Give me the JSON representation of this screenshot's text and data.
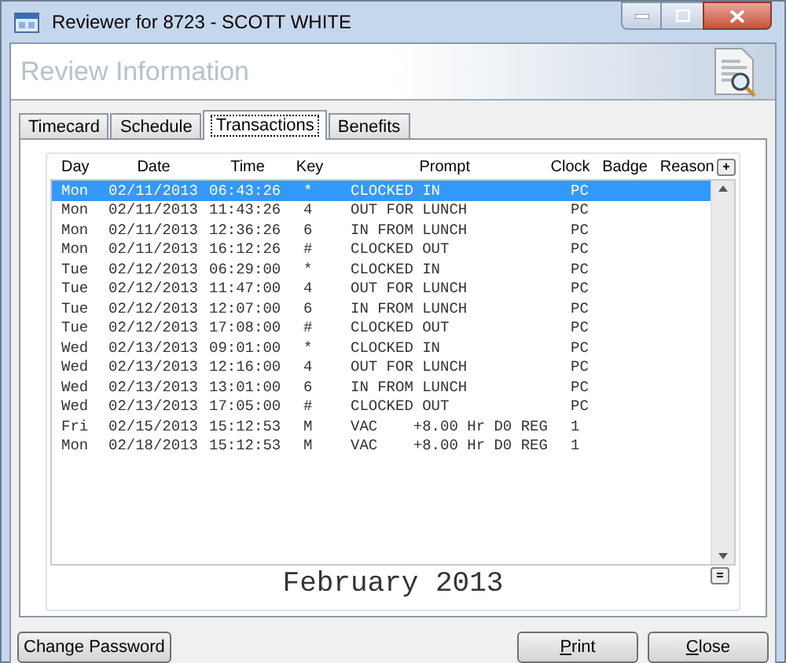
{
  "window": {
    "title": "Reviewer for 8723 - SCOTT WHITE"
  },
  "header": {
    "title": "Review Information"
  },
  "tabs": [
    {
      "label": "Timecard",
      "selected": false
    },
    {
      "label": "Schedule",
      "selected": false
    },
    {
      "label": "Transactions",
      "selected": true
    },
    {
      "label": "Benefits",
      "selected": false
    }
  ],
  "table": {
    "columns": [
      "Day",
      "Date",
      "Time",
      "Key",
      "Prompt",
      "Clock",
      "Badge",
      "Reason"
    ],
    "rows": [
      {
        "day": "Mon",
        "date": "02/11/2013",
        "time": "06:43:26",
        "key": "*",
        "prompt": "CLOCKED IN",
        "clock": "PC",
        "selected": true
      },
      {
        "day": "Mon",
        "date": "02/11/2013",
        "time": "11:43:26",
        "key": "4",
        "prompt": "OUT FOR LUNCH",
        "clock": "PC",
        "selected": false
      },
      {
        "day": "Mon",
        "date": "02/11/2013",
        "time": "12:36:26",
        "key": "6",
        "prompt": "IN FROM LUNCH",
        "clock": "PC",
        "selected": false
      },
      {
        "day": "Mon",
        "date": "02/11/2013",
        "time": "16:12:26",
        "key": "#",
        "prompt": "CLOCKED OUT",
        "clock": "PC",
        "selected": false
      },
      {
        "day": "Tue",
        "date": "02/12/2013",
        "time": "06:29:00",
        "key": "*",
        "prompt": "CLOCKED IN",
        "clock": "PC",
        "selected": false
      },
      {
        "day": "Tue",
        "date": "02/12/2013",
        "time": "11:47:00",
        "key": "4",
        "prompt": "OUT FOR LUNCH",
        "clock": "PC",
        "selected": false
      },
      {
        "day": "Tue",
        "date": "02/12/2013",
        "time": "12:07:00",
        "key": "6",
        "prompt": "IN FROM LUNCH",
        "clock": "PC",
        "selected": false
      },
      {
        "day": "Tue",
        "date": "02/12/2013",
        "time": "17:08:00",
        "key": "#",
        "prompt": "CLOCKED OUT",
        "clock": "PC",
        "selected": false
      },
      {
        "day": "Wed",
        "date": "02/13/2013",
        "time": "09:01:00",
        "key": "*",
        "prompt": "CLOCKED IN",
        "clock": "PC",
        "selected": false
      },
      {
        "day": "Wed",
        "date": "02/13/2013",
        "time": "12:16:00",
        "key": "4",
        "prompt": "OUT FOR LUNCH",
        "clock": "PC",
        "selected": false
      },
      {
        "day": "Wed",
        "date": "02/13/2013",
        "time": "13:01:00",
        "key": "6",
        "prompt": "IN FROM LUNCH",
        "clock": "PC",
        "selected": false
      },
      {
        "day": "Wed",
        "date": "02/13/2013",
        "time": "17:05:00",
        "key": "#",
        "prompt": "CLOCKED OUT",
        "clock": "PC",
        "selected": false
      },
      {
        "day": "Fri",
        "date": "02/15/2013",
        "time": "15:12:53",
        "key": "M",
        "prompt": "VAC    +8.00 Hr D0 REG",
        "clock": "1",
        "selected": false
      },
      {
        "day": "Mon",
        "date": "02/18/2013",
        "time": "15:12:53",
        "key": "M",
        "prompt": "VAC    +8.00 Hr D0 REG",
        "clock": "1",
        "selected": false
      }
    ]
  },
  "month_label": "February 2013",
  "buttons": {
    "change_password": "Change Password",
    "print": "Print",
    "close": "Close"
  }
}
